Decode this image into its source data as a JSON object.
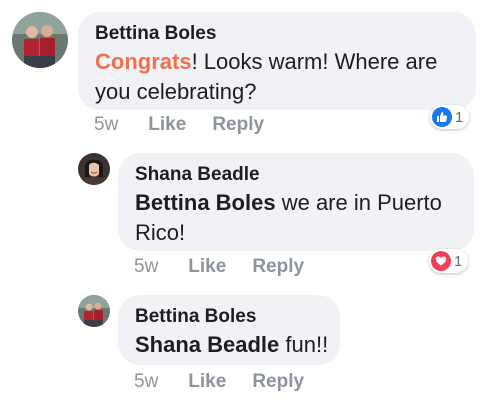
{
  "comments": [
    {
      "author": "Bettina Boles",
      "highlight": "Congrats",
      "text_line1": "! Looks warm! Where are",
      "text_line2": "you celebrating?",
      "time": "5w",
      "like_label": "Like",
      "reply_label": "Reply",
      "reaction": {
        "type": "like",
        "count": "1",
        "color": "#1877f2"
      }
    },
    {
      "author": "Shana Beadle",
      "mention": "Bettina Boles",
      "text_line1": " we are in Puerto",
      "text_line2": "Rico!",
      "time": "5w",
      "like_label": "Like",
      "reply_label": "Reply",
      "reaction": {
        "type": "love",
        "count": "1",
        "color": "#f33e58"
      }
    },
    {
      "author": "Bettina Boles",
      "mention": "Shana Beadle",
      "text": " fun!!",
      "time": "5w",
      "like_label": "Like",
      "reply_label": "Reply"
    }
  ],
  "colors": {
    "bubble": "#f0f2f5",
    "highlight": "#f0704f",
    "meta": "#8d949e"
  }
}
